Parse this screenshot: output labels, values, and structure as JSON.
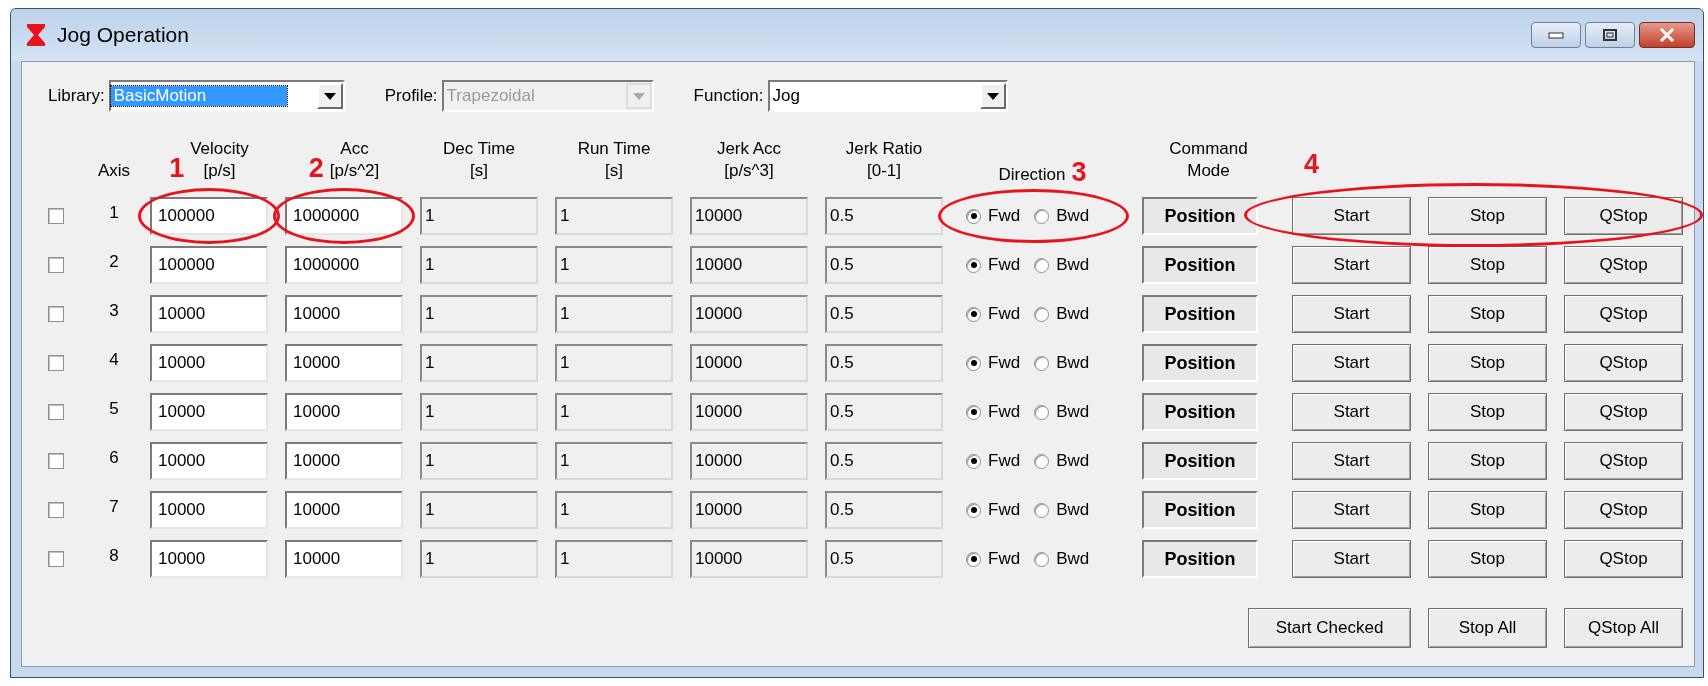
{
  "window": {
    "title": "Jog Operation"
  },
  "selectors": [
    {
      "label": "Library:",
      "value": "BasicMotion",
      "disabled": false,
      "highlighted": true
    },
    {
      "label": "Profile:",
      "value": "Trapezoidal",
      "disabled": true,
      "highlighted": false
    },
    {
      "label": "Function:",
      "value": "Jog",
      "disabled": false,
      "highlighted": false
    }
  ],
  "columns": [
    {
      "kind": "check"
    },
    {
      "kind": "axis",
      "heading": "Axis"
    },
    {
      "kind": "field",
      "heading": "Velocity\n[p/s]",
      "disabled": false,
      "annotation": "1"
    },
    {
      "kind": "field",
      "heading": "Acc\n[p/s^2]",
      "disabled": false,
      "annotation": "2"
    },
    {
      "kind": "field",
      "heading": "Dec Time\n[s]",
      "disabled": true
    },
    {
      "kind": "field",
      "heading": "Run Time\n[s]",
      "disabled": true
    },
    {
      "kind": "field",
      "heading": "Jerk Acc\n[p/s^3]",
      "disabled": true
    },
    {
      "kind": "field",
      "heading": "Jerk Ratio\n[0-1]",
      "disabled": true
    },
    {
      "kind": "direction",
      "heading": "Direction",
      "annotation": "3"
    },
    {
      "kind": "mode",
      "heading": "Command\nMode"
    },
    {
      "kind": "actions",
      "annotation": "4"
    }
  ],
  "rows": [
    {
      "axis": "1",
      "checked": false,
      "values": [
        "100000",
        "1000000",
        "1",
        "1",
        "10000",
        "0.5"
      ],
      "direction": [
        {
          "label": "Fwd",
          "selected": true
        },
        {
          "label": "Bwd",
          "selected": false
        }
      ],
      "mode": "Position",
      "buttons": [
        "Start",
        "Stop",
        "QStop"
      ]
    },
    {
      "axis": "2",
      "checked": false,
      "values": [
        "100000",
        "1000000",
        "1",
        "1",
        "10000",
        "0.5"
      ],
      "direction": [
        {
          "label": "Fwd",
          "selected": true
        },
        {
          "label": "Bwd",
          "selected": false
        }
      ],
      "mode": "Position",
      "buttons": [
        "Start",
        "Stop",
        "QStop"
      ]
    },
    {
      "axis": "3",
      "checked": false,
      "values": [
        "10000",
        "10000",
        "1",
        "1",
        "10000",
        "0.5"
      ],
      "direction": [
        {
          "label": "Fwd",
          "selected": true
        },
        {
          "label": "Bwd",
          "selected": false
        }
      ],
      "mode": "Position",
      "buttons": [
        "Start",
        "Stop",
        "QStop"
      ]
    },
    {
      "axis": "4",
      "checked": false,
      "values": [
        "10000",
        "10000",
        "1",
        "1",
        "10000",
        "0.5"
      ],
      "direction": [
        {
          "label": "Fwd",
          "selected": true
        },
        {
          "label": "Bwd",
          "selected": false
        }
      ],
      "mode": "Position",
      "buttons": [
        "Start",
        "Stop",
        "QStop"
      ]
    },
    {
      "axis": "5",
      "checked": false,
      "values": [
        "10000",
        "10000",
        "1",
        "1",
        "10000",
        "0.5"
      ],
      "direction": [
        {
          "label": "Fwd",
          "selected": true
        },
        {
          "label": "Bwd",
          "selected": false
        }
      ],
      "mode": "Position",
      "buttons": [
        "Start",
        "Stop",
        "QStop"
      ]
    },
    {
      "axis": "6",
      "checked": false,
      "values": [
        "10000",
        "10000",
        "1",
        "1",
        "10000",
        "0.5"
      ],
      "direction": [
        {
          "label": "Fwd",
          "selected": true
        },
        {
          "label": "Bwd",
          "selected": false
        }
      ],
      "mode": "Position",
      "buttons": [
        "Start",
        "Stop",
        "QStop"
      ]
    },
    {
      "axis": "7",
      "checked": false,
      "values": [
        "10000",
        "10000",
        "1",
        "1",
        "10000",
        "0.5"
      ],
      "direction": [
        {
          "label": "Fwd",
          "selected": true
        },
        {
          "label": "Bwd",
          "selected": false
        }
      ],
      "mode": "Position",
      "buttons": [
        "Start",
        "Stop",
        "QStop"
      ]
    },
    {
      "axis": "8",
      "checked": false,
      "values": [
        "10000",
        "10000",
        "1",
        "1",
        "10000",
        "0.5"
      ],
      "direction": [
        {
          "label": "Fwd",
          "selected": true
        },
        {
          "label": "Bwd",
          "selected": false
        }
      ],
      "mode": "Position",
      "buttons": [
        "Start",
        "Stop",
        "QStop"
      ]
    }
  ],
  "footer_buttons": [
    "Start Checked",
    "Stop All",
    "QStop All"
  ]
}
